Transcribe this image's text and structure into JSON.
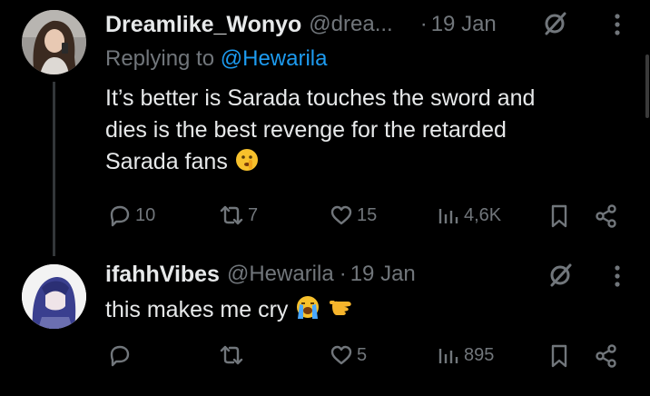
{
  "tweets": [
    {
      "display_name": "Dreamlike_Wonyo",
      "handle": "@drea...",
      "separator": "·",
      "time": "19 Jan",
      "replying_prefix": "Replying to",
      "replying_to": "@Hewarila",
      "text_lines": [
        "It’s better is Sarada touches the sword and",
        "dies is the best revenge for the retarded",
        "Sarada fans"
      ],
      "emoji": "shushing-face",
      "actions": {
        "replies": "10",
        "reposts": "7",
        "likes": "15",
        "views": "4,6K"
      }
    },
    {
      "display_name": "ifahhVibes",
      "handle": "@Hewarila",
      "separator": "·",
      "time": "19 Jan",
      "text": "this makes me cry",
      "emojis": [
        "loudly-crying-face",
        "call-me-hand"
      ],
      "actions": {
        "replies": "",
        "reposts": "",
        "likes": "5",
        "views": "895"
      }
    }
  ],
  "colors": {
    "background": "#000000",
    "text": "#e7e9ea",
    "muted": "#71767b",
    "link": "#1d9bf0",
    "thread_line": "#333639"
  }
}
